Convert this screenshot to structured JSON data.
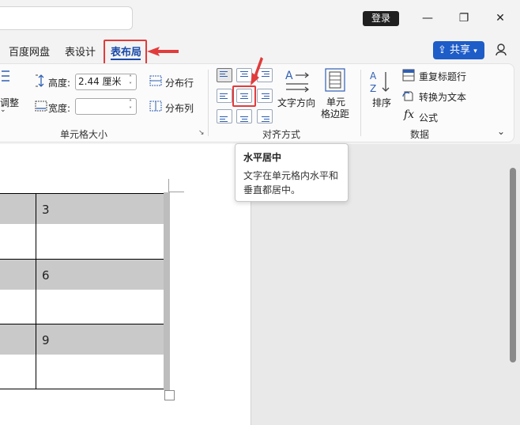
{
  "window": {
    "login_label": "登录"
  },
  "tabs": [
    {
      "label": "百度网盘"
    },
    {
      "label": "表设计"
    },
    {
      "label": "表布局"
    }
  ],
  "share_label": "共享",
  "cell_size": {
    "adjust_label": "调整",
    "height_label": "高度:",
    "height_value": "2.44 厘米",
    "width_label": "宽度:",
    "width_value": "",
    "distribute_rows": "分布行",
    "distribute_cols": "分布列",
    "group_label": "单元格大小"
  },
  "alignment": {
    "text_direction": "文字方向",
    "cell_margins_line1": "单元",
    "cell_margins_line2": "格边距",
    "group_label": "对齐方式"
  },
  "data_group": {
    "sort_label": "排序",
    "repeat_header": "重复标题行",
    "convert_text": "转换为文本",
    "formula": "公式",
    "group_label": "数据"
  },
  "tooltip": {
    "title": "水平居中",
    "body_line1": "文字在单元格内水平和",
    "body_line2": "垂直都居中。"
  },
  "table": {
    "cells": [
      "3",
      "6",
      "9"
    ]
  },
  "colors": {
    "accent": "#1a4aa8",
    "share": "#1e5cc8",
    "highlight": "#e23b3b",
    "cell_shade": "#c9c9c9"
  }
}
